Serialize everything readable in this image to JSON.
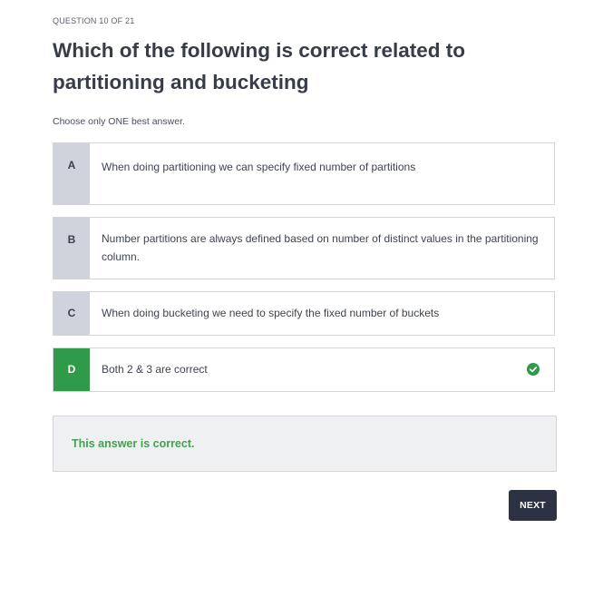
{
  "quiz": {
    "counter": "QUESTION 10 OF 21",
    "question": "Which of the following is correct related to partitioning and bucketing",
    "instruction": "Choose only ONE best answer.",
    "options": [
      {
        "letter": "A",
        "text": "When doing partitioning we can specify fixed number of partitions",
        "selected": false
      },
      {
        "letter": "B",
        "text": "Number partitions are always defined based on number of distinct values in the partitioning column.",
        "selected": false
      },
      {
        "letter": "C",
        "text": "When doing bucketing we need to specify the fixed number of buckets",
        "selected": false
      },
      {
        "letter": "D",
        "text": "Both 2 & 3 are correct",
        "selected": true,
        "icon": "check-circle-icon"
      }
    ],
    "feedback": "This answer is correct.",
    "next_label": "NEXT"
  },
  "colors": {
    "correct_green": "#2f9a48",
    "feedback_text": "#46a04e",
    "letter_bg": "#d1d3dc",
    "next_button_bg": "#2d3144"
  }
}
